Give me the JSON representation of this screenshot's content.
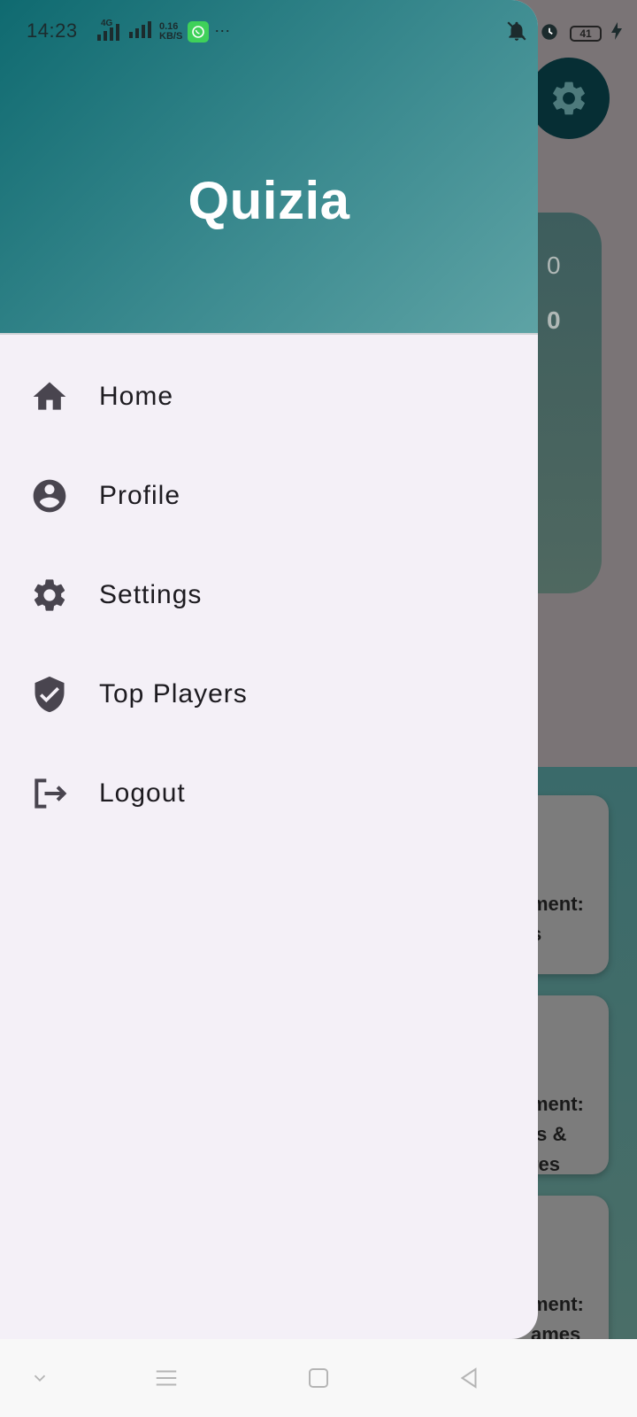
{
  "status_bar": {
    "time": "14:23",
    "network": "4G",
    "speed_value": "0.16",
    "speed_unit": "KB/S",
    "battery": "41",
    "icons": [
      "signal-icon",
      "signal-icon",
      "whatsapp-icon",
      "more-icon",
      "mute-icon",
      "alarm-icon",
      "battery-icon",
      "charging-icon"
    ]
  },
  "drawer": {
    "title": "Quizia",
    "header_colors": [
      "#0f6a70",
      "#5ea3a5"
    ],
    "items": [
      {
        "label": "Home",
        "icon": "home-icon"
      },
      {
        "label": "Profile",
        "icon": "account-circle-icon"
      },
      {
        "label": "Settings",
        "icon": "gear-icon"
      },
      {
        "label": "Top Players",
        "icon": "verified-shield-icon"
      },
      {
        "label": "Logout",
        "icon": "logout-icon"
      }
    ]
  },
  "background": {
    "score_top": "0",
    "score_bottom": "0",
    "cards": [
      {
        "lines": [
          "ment:",
          "s"
        ]
      },
      {
        "lines": [
          "ment:",
          "ls &",
          "res"
        ]
      },
      {
        "lines": [
          "ment:",
          "ames"
        ]
      }
    ]
  },
  "nav_bar": {
    "buttons": [
      "chevron-down-icon",
      "menu-icon",
      "home-square-icon",
      "back-icon"
    ]
  }
}
